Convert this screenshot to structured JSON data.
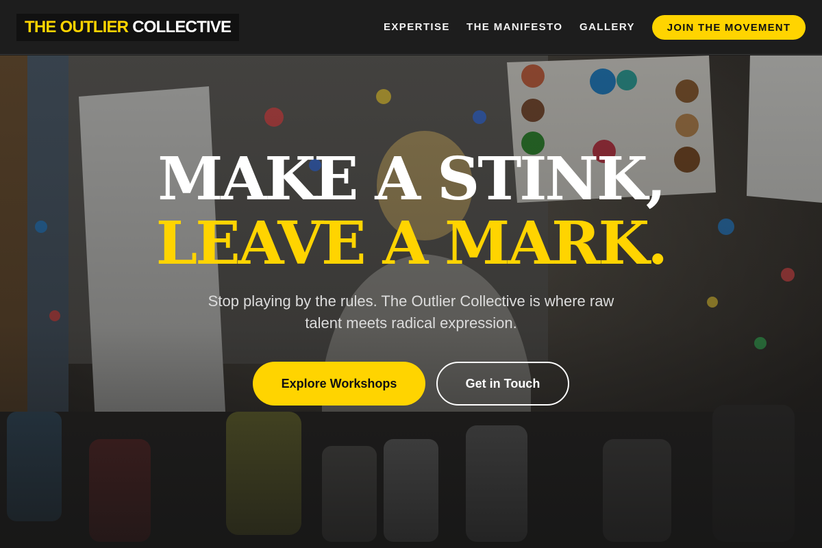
{
  "header": {
    "logo_accent": "THE OUTLIER",
    "logo_plain": "COLLECTIVE",
    "nav": [
      {
        "label": "EXPERTISE"
      },
      {
        "label": "THE MANIFESTO"
      },
      {
        "label": "GALLERY"
      }
    ],
    "join_label": "JOIN THE MOVEMENT"
  },
  "hero": {
    "headline_line1": "MAKE A STINK,",
    "headline_line2": "LEAVE A MARK.",
    "subtitle": "Stop playing by the rules. The Outlier Collective is where raw talent meets radical expression.",
    "primary_cta": "Explore Workshops",
    "secondary_cta": "Get in Touch",
    "background_image": "art-studio-photo"
  },
  "colors": {
    "accent": "#FFD400",
    "header_bg": "#1d1d1d",
    "text_light": "#ffffff"
  }
}
